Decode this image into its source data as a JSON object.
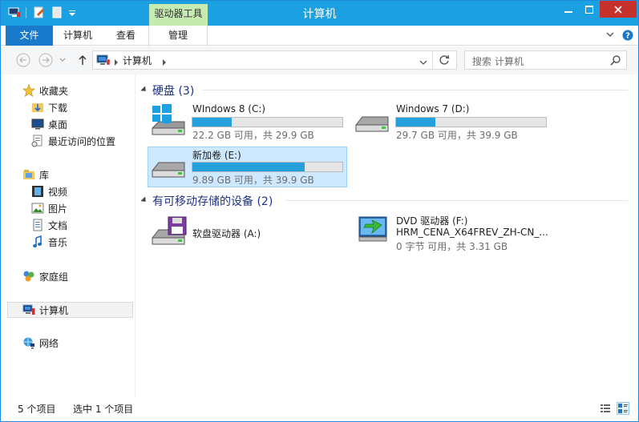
{
  "window": {
    "title": "计算机",
    "context_tab": "驱动器工具"
  },
  "ribbon": {
    "tabs": [
      {
        "label": "文件"
      },
      {
        "label": "计算机"
      },
      {
        "label": "查看"
      },
      {
        "label": "管理"
      }
    ]
  },
  "address": {
    "path": "计算机",
    "search_placeholder": "搜索 计算机"
  },
  "sidebar": {
    "items": [
      {
        "label": "收藏夹",
        "icon": "star-icon"
      },
      {
        "label": "下载",
        "icon": "download-folder-icon"
      },
      {
        "label": "桌面",
        "icon": "desktop-icon"
      },
      {
        "label": "最近访问的位置",
        "icon": "recent-places-icon"
      },
      {
        "label": "库",
        "icon": "library-icon"
      },
      {
        "label": "视频",
        "icon": "video-icon"
      },
      {
        "label": "图片",
        "icon": "picture-icon"
      },
      {
        "label": "文档",
        "icon": "document-icon"
      },
      {
        "label": "音乐",
        "icon": "music-icon"
      },
      {
        "label": "家庭组",
        "icon": "homegroup-icon"
      },
      {
        "label": "计算机",
        "icon": "computer-icon"
      },
      {
        "label": "网络",
        "icon": "network-icon"
      }
    ]
  },
  "groups": {
    "hdd": {
      "title": "硬盘 (3)"
    },
    "removable": {
      "title": "有可移动存储的设备 (2)"
    }
  },
  "drives": {
    "c": {
      "name": "WIndows 8 (C:)",
      "info": "22.2 GB 可用，共 29.9 GB",
      "used_fraction": 0.26
    },
    "d": {
      "name": "Windows 7 (D:)",
      "info": "29.7 GB 可用，共 39.9 GB",
      "used_fraction": 0.26
    },
    "e": {
      "name": "新加卷 (E:)",
      "info": "9.89 GB 可用，共 39.9 GB",
      "used_fraction": 0.75
    },
    "a": {
      "name": "软盘驱动器 (A:)"
    },
    "f": {
      "name": "DVD 驱动器 (F:)",
      "label": "HRM_CENA_X64FREV_ZH-CN_...",
      "info": "0 字节 可用，共 3.31 GB"
    }
  },
  "status": {
    "count": "5 个项目",
    "selected": "选中 1 个项目"
  },
  "colors": {
    "titlebar": "#1ba1e2",
    "file_tab": "#1979ca",
    "context_tab": "#c6ebb0",
    "selection": "#cde8ff",
    "bar_fill": "#26a0da",
    "group_text": "#1e3287"
  }
}
